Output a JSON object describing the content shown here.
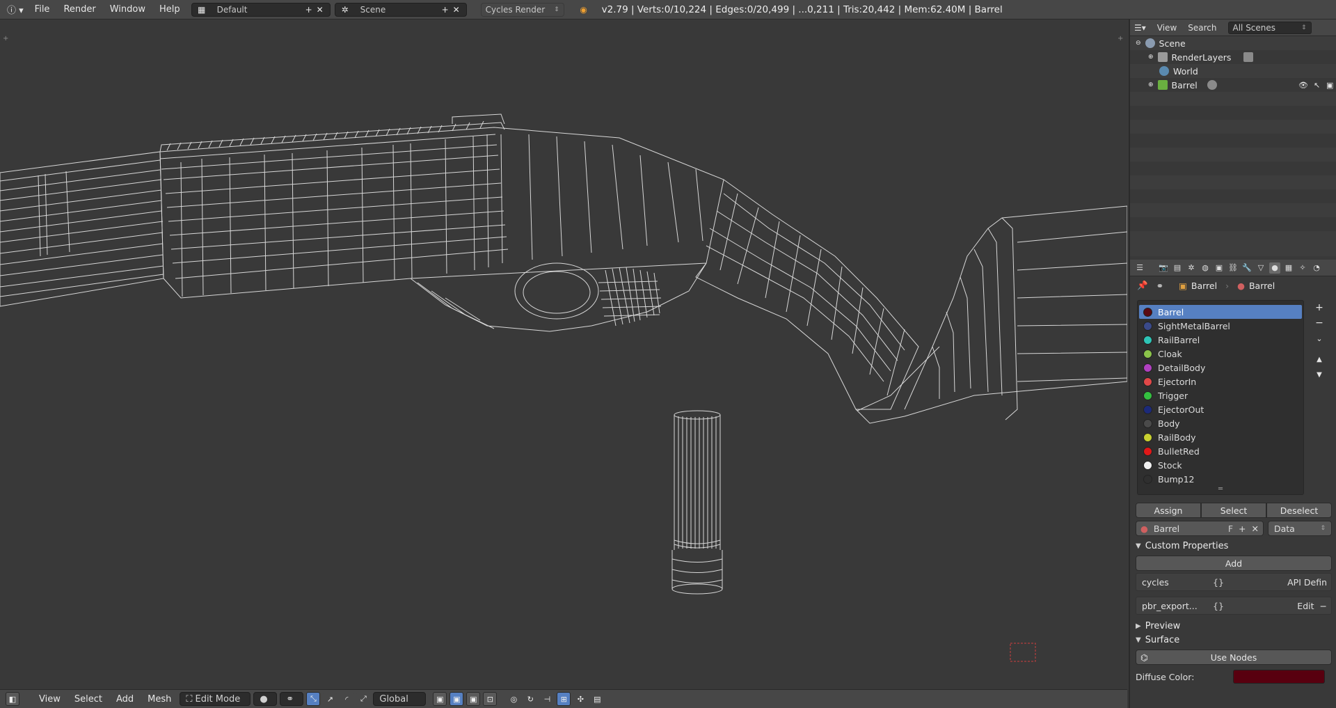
{
  "topbar": {
    "menus": [
      "File",
      "Render",
      "Window",
      "Help"
    ],
    "layout_name": "Default",
    "scene_name": "Scene",
    "engine": "Cycles Render",
    "status": "v2.79 | Verts:0/10,224 | Edges:0/20,499 | ...0,211 | Tris:20,442 | Mem:62.40M | Barrel"
  },
  "viewport_header": {
    "menus": [
      "View",
      "Select",
      "Add",
      "Mesh"
    ],
    "mode": "Edit Mode",
    "orientation": "Global"
  },
  "outliner": {
    "header": {
      "view": "View",
      "search": "Search",
      "filter": "All Scenes"
    },
    "items": [
      {
        "label": "Scene",
        "icon": "scene-icon"
      },
      {
        "label": "RenderLayers",
        "icon": "render-layers-icon"
      },
      {
        "label": "World",
        "icon": "world-icon"
      },
      {
        "label": "Barrel",
        "icon": "mesh-icon"
      }
    ]
  },
  "properties": {
    "context": {
      "object": "Barrel",
      "material": "Barrel"
    },
    "materials": [
      {
        "name": "Barrel",
        "color": "#5a0a12",
        "selected": true
      },
      {
        "name": "SightMetalBarrel",
        "color": "#3a4a8a"
      },
      {
        "name": "RailBarrel",
        "color": "#2ec4b6"
      },
      {
        "name": "Cloak",
        "color": "#8bc34a"
      },
      {
        "name": "DetailBody",
        "color": "#b040c0"
      },
      {
        "name": "EjectorIn",
        "color": "#e04848"
      },
      {
        "name": "Trigger",
        "color": "#34c040"
      },
      {
        "name": "EjectorOut",
        "color": "#1c2a7a"
      },
      {
        "name": "Body",
        "color": "#4a4a4a"
      },
      {
        "name": "RailBody",
        "color": "#c8d030"
      },
      {
        "name": "BulletRed",
        "color": "#e01818"
      },
      {
        "name": "Stock",
        "color": "#f0f0f0"
      },
      {
        "name": "Bump12",
        "color": "#2f2f2f"
      }
    ],
    "assign_buttons": [
      "Assign",
      "Select",
      "Deselect"
    ],
    "slot": {
      "material": "Barrel",
      "fake": "F",
      "link": "Data"
    },
    "custom_properties": {
      "title": "Custom Properties",
      "add": "Add",
      "rows": [
        {
          "name": "cycles",
          "value": "{}",
          "action": "API Defin"
        },
        {
          "name": "pbr_export...",
          "value": "{}",
          "action": "Edit"
        }
      ]
    },
    "preview_title": "Preview",
    "surface": {
      "title": "Surface",
      "use_nodes": "Use Nodes",
      "diffuse_label": "Diffuse Color:",
      "diffuse_color": "#58000f"
    }
  }
}
